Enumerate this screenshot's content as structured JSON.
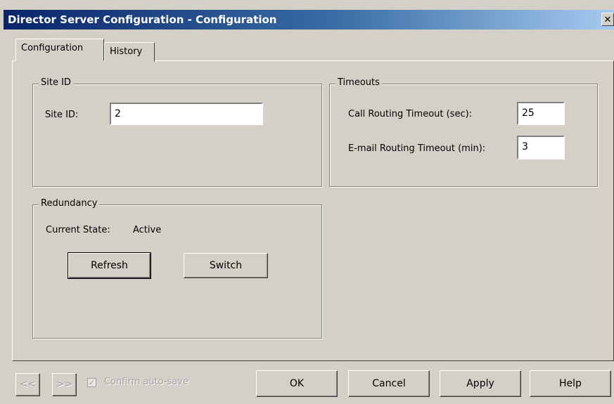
{
  "window": {
    "title": "Director Server Configuration - Configuration",
    "close_glyph": "✕"
  },
  "tabs": [
    {
      "label": "Configuration",
      "active": true
    },
    {
      "label": "History",
      "active": false
    }
  ],
  "site_id": {
    "group_label": "Site ID",
    "field_label": "Site ID:",
    "value": "2"
  },
  "timeouts": {
    "group_label": "Timeouts",
    "call_label": "Call Routing Timeout (sec):",
    "call_value": "25",
    "email_label": "E-mail Routing Timeout (min):",
    "email_value": "3"
  },
  "redundancy": {
    "group_label": "Redundancy",
    "state_label": "Current State:",
    "state_value": "Active",
    "refresh_label": "Refresh",
    "switch_label": "Switch"
  },
  "footer": {
    "prev_label": "<<",
    "next_label": ">>",
    "confirm_label": "Confirm auto-save",
    "confirm_checked": true,
    "check_glyph": "✓",
    "ok_label": "OK",
    "cancel_label": "Cancel",
    "apply_label": "Apply",
    "help_label": "Help"
  }
}
